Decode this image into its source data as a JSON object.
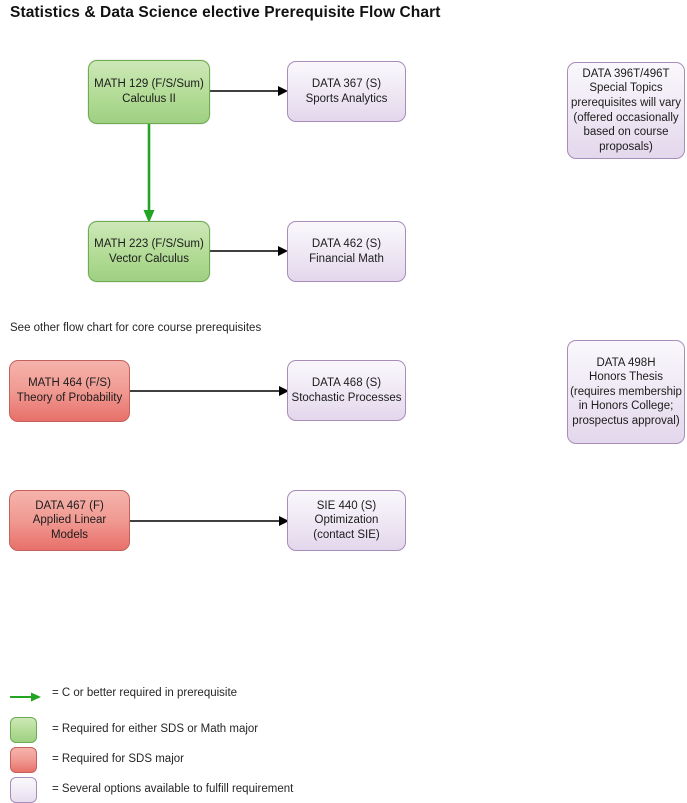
{
  "title": "Statistics & Data Science elective Prerequisite Flow Chart",
  "notes": {
    "core_courses": "See other flow chart for core course prerequisites"
  },
  "colors": {
    "green_fill": "#b3dc96",
    "green_border": "#6faa54",
    "red_fill": "#f09a92",
    "red_border": "#c4615c",
    "purple_fill": "#ece4f2",
    "purple_border": "#a98cba",
    "arrow_black": "#000000",
    "arrow_green": "#2ca02c"
  },
  "nodes": {
    "math129": {
      "id": "math-129",
      "type": "green",
      "lines": [
        "MATH 129 (F/S/Sum)",
        "Calculus II"
      ],
      "line1": "MATH 129 (F/S/Sum)",
      "line2": "Calculus II"
    },
    "data367": {
      "id": "data-367",
      "type": "purple",
      "line1": "DATA 367 (S)",
      "line2": "Sports Analytics"
    },
    "data396t": {
      "id": "data-396t-496t",
      "type": "purple",
      "line1": "DATA 396T/496T",
      "line2": "Special Topics",
      "line3": "prerequisites will vary",
      "line4": "(offered occasionally",
      "line5": "based on course",
      "line6": "proposals)"
    },
    "math223": {
      "id": "math-223",
      "type": "green",
      "line1": "MATH 223 (F/S/Sum)",
      "line2": "Vector Calculus"
    },
    "data462": {
      "id": "data-462",
      "type": "purple",
      "line1": "DATA 462 (S)",
      "line2": "Financial Math"
    },
    "math464": {
      "id": "math-464",
      "type": "red",
      "line1": "MATH 464 (F/S)",
      "line2": "Theory of Probability"
    },
    "data468": {
      "id": "data-468",
      "type": "purple",
      "line1": "DATA 468 (S)",
      "line2": "Stochastic Processes"
    },
    "data498h": {
      "id": "data-498h",
      "type": "purple",
      "line1": "DATA 498H",
      "line2": "Honors Thesis",
      "line3": "(requires membership",
      "line4": "in Honors College;",
      "line5": "prospectus approval)"
    },
    "data467": {
      "id": "data-467",
      "type": "red",
      "line1": "DATA 467 (F)",
      "line2": "Applied Linear",
      "line3": "Models"
    },
    "sie440": {
      "id": "sie-440",
      "type": "purple",
      "line1": "SIE 440 (S)",
      "line2": "Optimization",
      "line3": "(contact SIE)"
    }
  },
  "edges": [
    {
      "from": "MATH 129 (F/S/Sum) Calculus II",
      "to": "DATA 367 (S) Sports Analytics",
      "style": "black"
    },
    {
      "from": "MATH 129 (F/S/Sum) Calculus II",
      "to": "MATH 223 (F/S/Sum) Vector Calculus",
      "style": "green"
    },
    {
      "from": "MATH 223 (F/S/Sum) Vector Calculus",
      "to": "DATA 462 (S) Financial Math",
      "style": "black"
    },
    {
      "from": "MATH 464 (F/S) Theory of Probability",
      "to": "DATA 468 (S) Stochastic Processes",
      "style": "black"
    },
    {
      "from": "DATA 467 (F) Applied Linear Models",
      "to": "SIE 440 (S) Optimization (contact SIE)",
      "style": "black"
    }
  ],
  "legend": {
    "items": [
      {
        "swatch": "green-arrow",
        "label": "= C or better required in prerequisite"
      },
      {
        "swatch": "green-box",
        "label": "= Required for either SDS or Math major"
      },
      {
        "swatch": "red-box",
        "label": "= Required for SDS major"
      },
      {
        "swatch": "purple-box",
        "label": "= Several options available to fulfill requirement"
      }
    ]
  }
}
